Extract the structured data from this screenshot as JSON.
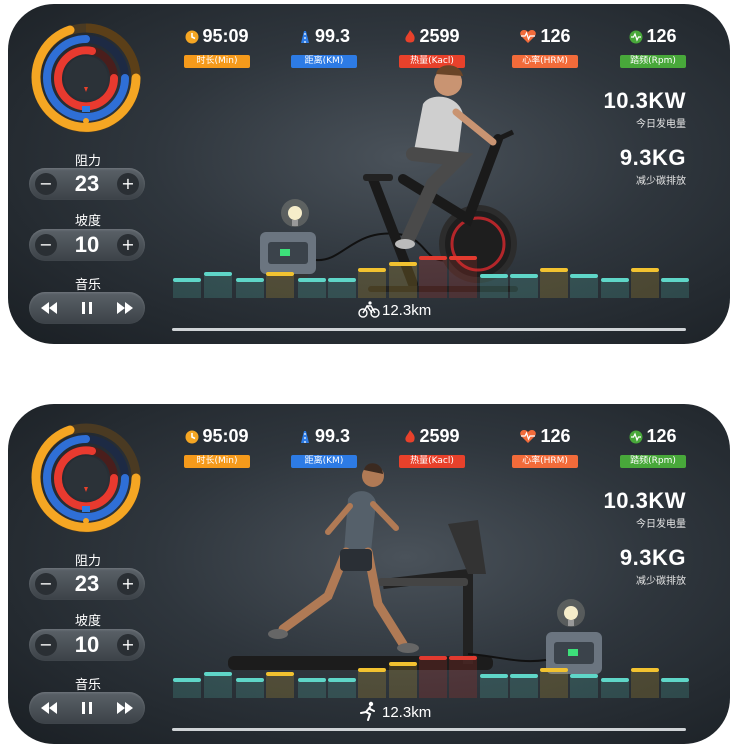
{
  "panels": [
    {
      "mode": "bike",
      "stats": [
        {
          "value": "95:09",
          "label": "时长(Min)",
          "color": "#f59a1b",
          "icon": "clock-icon"
        },
        {
          "value": "99.3",
          "label": "距离(KM)",
          "color": "#2d7be5",
          "icon": "road-icon"
        },
        {
          "value": "2599",
          "label": "热量(Kacl)",
          "color": "#e8412b",
          "icon": "flame-icon"
        },
        {
          "value": "126",
          "label": "心率(HRM)",
          "color": "#f26b3a",
          "icon": "heart-rate-icon"
        },
        {
          "value": "126",
          "label": "踏频(Rpm)",
          "color": "#48a83a",
          "icon": "cadence-icon"
        }
      ],
      "power": {
        "value": "10.3KW",
        "label": "今日发电量"
      },
      "carbon": {
        "value": "9.3KG",
        "label": "减少碳排放"
      },
      "resistance": {
        "label": "阻力",
        "value": "23"
      },
      "incline": {
        "label": "坡度",
        "value": "10"
      },
      "music": {
        "label": "音乐"
      },
      "distance": "12.3km"
    },
    {
      "mode": "treadmill",
      "stats": [
        {
          "value": "95:09",
          "label": "时长(Min)",
          "color": "#f59a1b",
          "icon": "clock-icon"
        },
        {
          "value": "99.3",
          "label": "距离(KM)",
          "color": "#2d7be5",
          "icon": "road-icon"
        },
        {
          "value": "2599",
          "label": "热量(Kacl)",
          "color": "#e8412b",
          "icon": "flame-icon"
        },
        {
          "value": "126",
          "label": "心率(HRM)",
          "color": "#f26b3a",
          "icon": "heart-rate-icon"
        },
        {
          "value": "126",
          "label": "踏频(Rpm)",
          "color": "#48a83a",
          "icon": "cadence-icon"
        }
      ],
      "power": {
        "value": "10.3KW",
        "label": "今日发电量"
      },
      "carbon": {
        "value": "9.3KG",
        "label": "减少碳排放"
      },
      "resistance": {
        "label": "阻力",
        "value": "23"
      },
      "incline": {
        "label": "坡度",
        "value": "10"
      },
      "music": {
        "label": "音乐"
      },
      "distance": "12.3km"
    }
  ],
  "colors": {
    "ring_orange": "#f5a623",
    "ring_blue": "#2f6fd6",
    "ring_red": "#e83a2f",
    "bar_teal": "#5fd6c8",
    "bar_yellow": "#f2c230",
    "bar_red": "#e23a2f"
  }
}
